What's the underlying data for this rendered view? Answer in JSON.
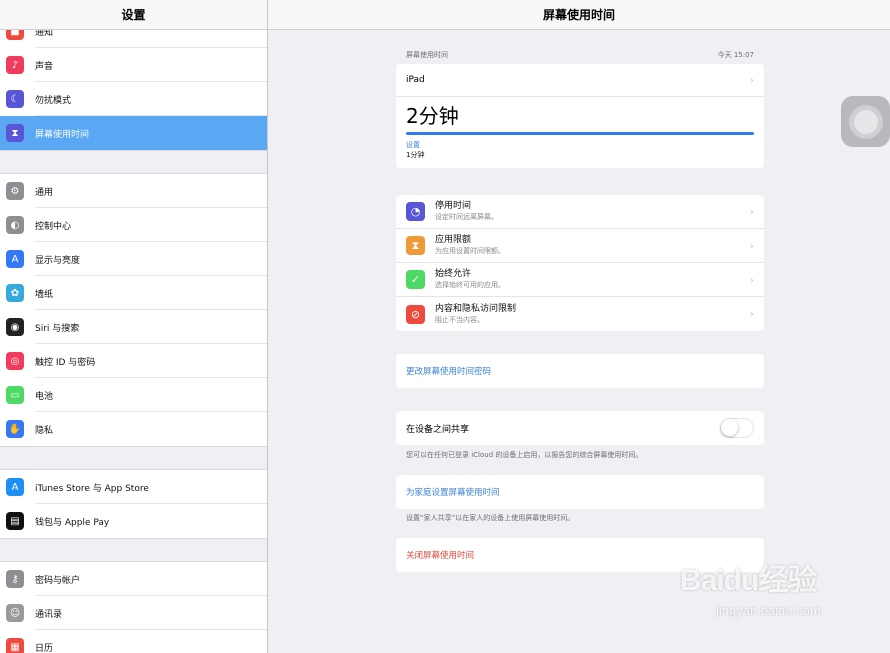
{
  "sidebar": {
    "title": "设置",
    "groups": [
      [
        {
          "label": "通知",
          "icon": "notifications-icon",
          "color": "#f04a3f"
        },
        {
          "label": "声音",
          "icon": "sound-icon",
          "color": "#f03c5c"
        },
        {
          "label": "勿扰模式",
          "icon": "moon-icon",
          "color": "#5856d6"
        },
        {
          "label": "屏幕使用时间",
          "icon": "hourglass-icon",
          "color": "#5856d6",
          "selected": true
        }
      ],
      [
        {
          "label": "通用",
          "icon": "gear-icon",
          "color": "#8e8e93"
        },
        {
          "label": "控制中心",
          "icon": "control-center-icon",
          "color": "#8e8e93"
        },
        {
          "label": "显示与亮度",
          "icon": "display-icon",
          "color": "#3478f6"
        },
        {
          "label": "墙纸",
          "icon": "wallpaper-icon",
          "color": "#36aadc"
        },
        {
          "label": "Siri 与搜索",
          "icon": "siri-icon",
          "color": "#222"
        },
        {
          "label": "触控 ID 与密码",
          "icon": "fingerprint-icon",
          "color": "#f03c5c"
        },
        {
          "label": "电池",
          "icon": "battery-icon",
          "color": "#4cd964"
        },
        {
          "label": "隐私",
          "icon": "hand-icon",
          "color": "#3478f6"
        }
      ],
      [
        {
          "label": "iTunes Store 与 App Store",
          "icon": "app-store-icon",
          "color": "#1d8ff5"
        },
        {
          "label": "钱包与 Apple Pay",
          "icon": "wallet-icon",
          "color": "#111"
        }
      ],
      [
        {
          "label": "密码与帐户",
          "icon": "key-icon",
          "color": "#8e8e93"
        },
        {
          "label": "通讯录",
          "icon": "contacts-icon",
          "color": "#9a9a9a"
        },
        {
          "label": "日历",
          "icon": "calendar-icon",
          "color": "#f04a3f"
        }
      ]
    ]
  },
  "main": {
    "title": "屏幕使用时间",
    "summary": {
      "section_label": "屏幕使用时间",
      "timestamp": "今天 15:07",
      "device": "iPad",
      "total": "2分钟",
      "progress": 1.0,
      "category": "设置",
      "category_time": "1分钟"
    },
    "items": [
      {
        "title": "停用时间",
        "subtitle": "设定时间远离屏幕。",
        "icon": "downtime-icon",
        "color": "#5856d6"
      },
      {
        "title": "应用限额",
        "subtitle": "为应用设置时间限额。",
        "icon": "hourglass-icon",
        "color": "#f09a37"
      },
      {
        "title": "始终允许",
        "subtitle": "选择始终可用的应用。",
        "icon": "checkmark-icon",
        "color": "#4cd964"
      },
      {
        "title": "内容和隐私访问限制",
        "subtitle": "阻止不当内容。",
        "icon": "restrict-icon",
        "color": "#f04a3f"
      }
    ],
    "change_passcode": "更改屏幕使用时间密码",
    "share": {
      "label": "在设备之间共享",
      "footnote": "您可以在任何已登录 iCloud 的设备上启用，以报告您的综合屏幕使用时间。",
      "enabled": false
    },
    "family": {
      "label": "为家庭设置屏幕使用时间",
      "footnote": "设置“家人共享”以在家人的设备上使用屏幕使用时间。"
    },
    "turn_off": "关闭屏幕使用时间"
  },
  "watermark": {
    "top": "Baidu经验",
    "bottom": "jingyan.baidu.com"
  },
  "colors": {
    "accent": "#3b82d6",
    "selected": "#5aa7f4",
    "danger": "#e0453a",
    "progress": "#2f7ff0"
  }
}
